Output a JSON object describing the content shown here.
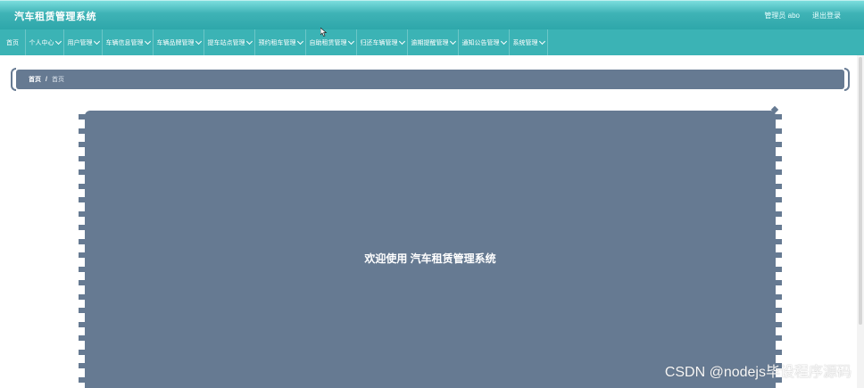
{
  "header": {
    "title": "汽车租赁管理系统",
    "user_label": "管理员 abo",
    "logout_label": "退出登录"
  },
  "nav": {
    "items": [
      {
        "label": "首页",
        "dropdown": false
      },
      {
        "label": "个人中心",
        "dropdown": true
      },
      {
        "label": "用户管理",
        "dropdown": true
      },
      {
        "label": "车辆信息管理",
        "dropdown": true
      },
      {
        "label": "车辆品牌管理",
        "dropdown": true
      },
      {
        "label": "提车站点管理",
        "dropdown": true
      },
      {
        "label": "预约租车管理",
        "dropdown": true
      },
      {
        "label": "自助租赁管理",
        "dropdown": true
      },
      {
        "label": "归还车辆管理",
        "dropdown": true
      },
      {
        "label": "逾期提醒管理",
        "dropdown": true
      },
      {
        "label": "通知公告管理",
        "dropdown": true
      },
      {
        "label": "系统管理",
        "dropdown": true
      }
    ]
  },
  "breadcrumb": {
    "home": "首页",
    "separator": "/",
    "current": "首页"
  },
  "main": {
    "welcome_text": "欢迎使用 汽车租赁管理系统"
  },
  "watermark": "CSDN @nodejs毕设程序源码",
  "colors": {
    "header_teal": "#3fb3b6",
    "nav_teal": "#3bb3b5",
    "panel_slate": "#667a92"
  }
}
